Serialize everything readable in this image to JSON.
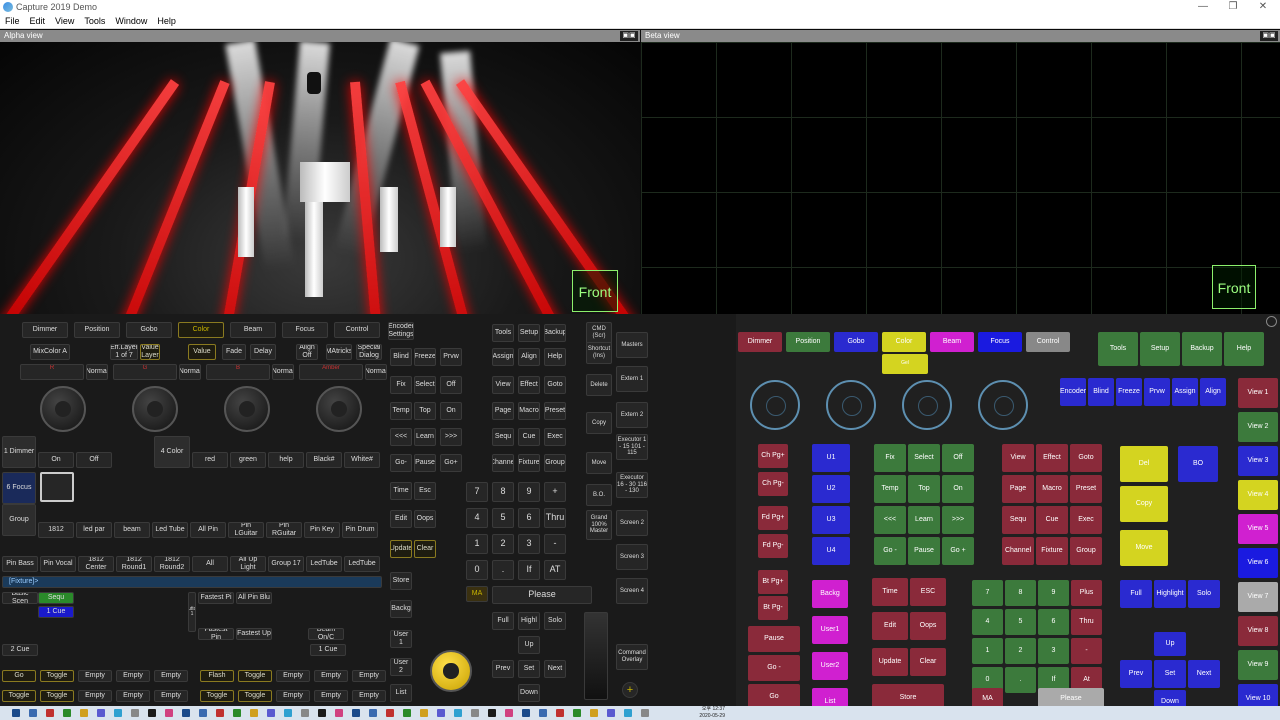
{
  "app": {
    "title": "Capture 2019 Demo"
  },
  "menu": [
    "File",
    "Edit",
    "View",
    "Tools",
    "Window",
    "Help"
  ],
  "views": {
    "alpha": "Alpha view",
    "beta": "Beta view",
    "front": "Front"
  },
  "left": {
    "top_row": [
      "Dimmer",
      "Position",
      "Gobo",
      "Color",
      "Beam",
      "Focus",
      "Control"
    ],
    "encoder_settings": "Encoder Settings",
    "sub_row": [
      "MixColor A",
      "Eff.Layer 1 of 7",
      "Value Layer",
      "Value",
      "Fade",
      "Delay",
      "Align Off",
      "MAtricks",
      "Special Dialog"
    ],
    "enc_vals": [
      [
        "R",
        "100.0"
      ],
      [
        "G",
        "0.0 Min"
      ],
      [
        "B",
        "0.0 Min"
      ],
      [
        "Amber",
        "0.0 Min"
      ]
    ],
    "normal": "Normal",
    "presets_row1": [
      "On",
      "Off",
      "red",
      "green",
      "help",
      "Black#",
      "White#"
    ],
    "presets_row2": [
      "1812",
      "led par",
      "beam",
      "Led Tube",
      "All Pin",
      "Pin LGuitar",
      "Pin RGuitar",
      "Pin Key",
      "Pin Drum"
    ],
    "presets_row3": [
      "Pin Bass",
      "Pin Vocal",
      "1812 Center",
      "1812 Round1",
      "1812 Round2",
      "All",
      "All Up Light",
      "Group 17",
      "LedTube",
      "LedTube"
    ],
    "side_labels": [
      "1 Dimmer",
      "6 Focus",
      "Group",
      "4 Color"
    ],
    "fixture_label": "[Fixture]>",
    "exec_titles": [
      "Basic Scen",
      "Sequ",
      "Fastest Pi",
      "All Pin Blu",
      "Beam On/C",
      "Fastest Pin",
      "Fastest Up"
    ],
    "cue_labels": [
      "1 Cue",
      "2 Cue",
      "1 Cue"
    ],
    "toggle": "Toggle",
    "empty": "Empty",
    "go": "Go",
    "flash": "Flash",
    "button_label": "Button 1",
    "cmd_keys": [
      "Tools",
      "Setup",
      "Backup",
      "Blind",
      "Freeze",
      "Prvw",
      "Assign",
      "Align",
      "Help",
      "Fix",
      "Select",
      "Off",
      "View",
      "Effect",
      "Goto",
      "Temp",
      "Top",
      "On",
      "Page",
      "Macro",
      "Preset",
      "<<<",
      "Learn",
      ">>>",
      "Sequ",
      "Cue",
      "Exec",
      "Go-",
      "Pause",
      "Go+",
      "Channel",
      "Fixture",
      "Group",
      "Time",
      "Esc",
      "Edit",
      "Oops",
      "Update",
      "Clear",
      "Store",
      "Backg",
      "User 1",
      "User 2",
      "List",
      "Full",
      "Highl",
      "Solo",
      "Up",
      "Prev",
      "Set",
      "Next",
      "Down"
    ],
    "num_keys": [
      "7",
      "8",
      "9",
      "+",
      "4",
      "5",
      "6",
      "Thru",
      "1",
      "2",
      "3",
      "-",
      "0",
      ".",
      "If",
      "AT"
    ],
    "please": "Please",
    "ma": "MA",
    "cmd_side": [
      "CMD (Scr)",
      "Shortcut (Ins)",
      "Delete",
      "Copy",
      "Move",
      "B.O.",
      "Grand 100% Master"
    ],
    "masters": [
      "Masters",
      "Extern 1",
      "Extern 2",
      "Executor 1 - 15 101 - 115",
      "Executor 16 - 30 116 - 130",
      "Screen 2",
      "Screen 3",
      "Screen 4",
      "Command Overlay"
    ]
  },
  "right": {
    "top_row": [
      "Dimmer",
      "Position",
      "Gobo",
      "Color",
      "Beam",
      "Focus",
      "Control"
    ],
    "color_sub": "Gel",
    "top_right": [
      "Tools",
      "Setup",
      "Backup",
      "Help"
    ],
    "enc_row": [
      "Encoder",
      "Blind",
      "Freeze",
      "Prvw",
      "Assign",
      "Align"
    ],
    "views": [
      "View 1",
      "View 2",
      "View 3",
      "View 4",
      "View 5",
      "View 6",
      "View 7",
      "View 8",
      "View 9",
      "View 10"
    ],
    "chpg": [
      "Ch Pg+",
      "Ch Pg-",
      "Fd Pg+",
      "Fd Pg-",
      "Bt Pg+",
      "Bt Pg-"
    ],
    "users": [
      "U1",
      "U2",
      "U3",
      "U4"
    ],
    "block1": [
      "Fix",
      "Select",
      "Off",
      "Temp",
      "Top",
      "On",
      "<<<",
      "Learn",
      ">>>",
      "Go -",
      "Pause",
      "Go +"
    ],
    "block2": [
      "View",
      "Effect",
      "Goto",
      "Page",
      "Macro",
      "Preset",
      "Sequ",
      "Cue",
      "Exec",
      "Channel",
      "Fixture",
      "Group"
    ],
    "del": "Del",
    "bo": "BO",
    "copy": "Copy",
    "move": "Move",
    "left_bottom": [
      "Pause",
      "Go -",
      "Go"
    ],
    "magenta": [
      "Backg",
      "User1",
      "User2",
      "List"
    ],
    "timeblock": [
      "Time",
      "ESC",
      "Edit",
      "Oops",
      "Update",
      "Clear",
      "Store"
    ],
    "num": [
      "7",
      "8",
      "9",
      "Plus",
      "4",
      "5",
      "6",
      "Thru",
      "1",
      "2",
      "3",
      "-",
      "0",
      ".",
      "If",
      "At"
    ],
    "ma": "MA",
    "please": "Please",
    "fhs": [
      "Full",
      "Highlight",
      "Solo"
    ],
    "arrows": {
      "up": "Up",
      "prev": "Prev",
      "set": "Set",
      "next": "Next",
      "down": "Down"
    }
  },
  "taskbar": {
    "time": "오후 12:37",
    "date": "2020-05-29"
  },
  "colors": {
    "accent": "#c8b400",
    "red": "#ff2020"
  }
}
